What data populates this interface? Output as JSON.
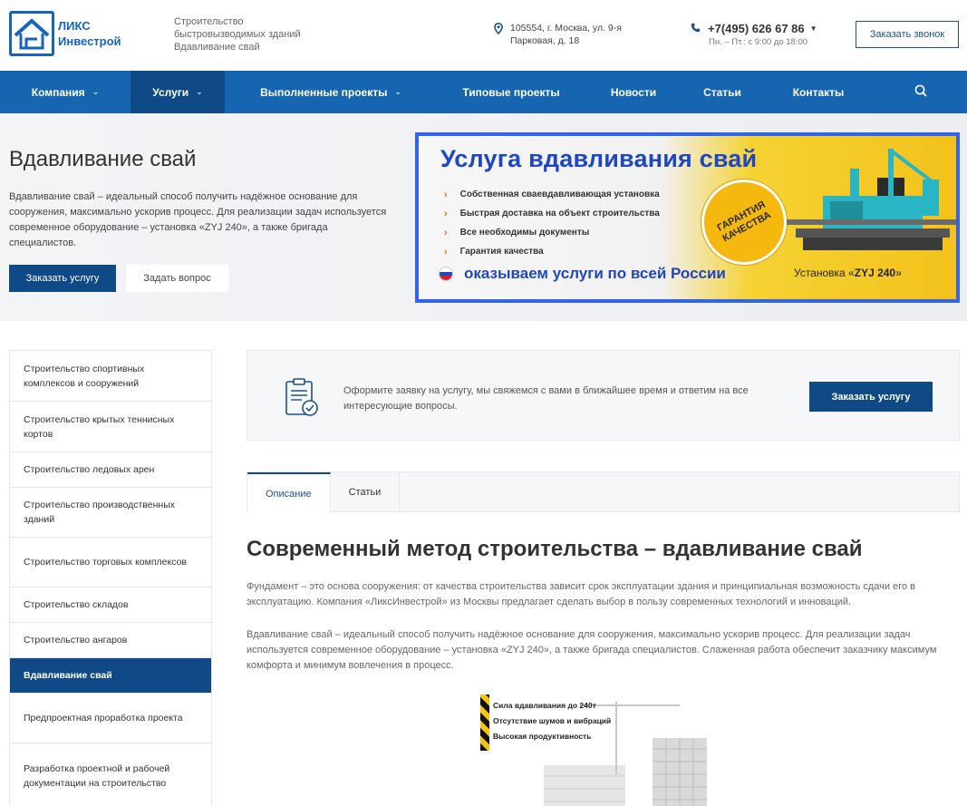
{
  "header": {
    "logo_line1": "ЛИКС",
    "logo_line2": "Инвестрой",
    "tagline": [
      "Строительство",
      "быстровызводимых зданий",
      "Вдавливание свай"
    ],
    "address_line1": "105554, г. Москва, ул. 9-я",
    "address_line2": "Парковая, д. 18",
    "phone": "+7(495) 626 67 86",
    "hours": "Пн. – Пт.: с 9:00 до 18:00",
    "callback_label": "Заказать звонок"
  },
  "nav": {
    "items": [
      {
        "label": "Компания",
        "dropdown": true
      },
      {
        "label": "Услуги",
        "dropdown": true,
        "active": true
      },
      {
        "label": "Выполненные проекты",
        "dropdown": true
      },
      {
        "label": "Типовые проекты"
      },
      {
        "label": "Новости"
      },
      {
        "label": "Статьи"
      },
      {
        "label": "Контакты"
      }
    ]
  },
  "hero": {
    "title": "Вдавливание свай",
    "text": "Вдавливание свай – идеальный способ получить надёжное основание для сооружения, максимально ускорив процесс. Для реализации задач используется современное оборудование – установка «ZYJ 240», а также бригада специалистов.",
    "primary_label": "Заказать услугу",
    "secondary_label": "Задать вопрос"
  },
  "banner": {
    "title": "Услуга вдавливания свай",
    "points": [
      "Собственная сваевдавливающая установка",
      "Быстрая доставка на объект строительства",
      "Все необходимы документы",
      "Гарантия качества"
    ],
    "footer": "оказываем услуги по всей России",
    "stamp_line1": "ГАРАНТИЯ",
    "stamp_line2": "КАЧЕСТВА",
    "caption_prefix": "Установка «",
    "caption_model": "ZYJ 240",
    "caption_suffix": "»"
  },
  "sidebar": {
    "items": [
      "Строительство спортивных комплексов и сооружений",
      "Строительство крытых теннисных кортов",
      "Строительство ледовых арен",
      "Строительство производственных зданий",
      "Строительство торговых комплексов",
      "Строительство складов",
      "Строительство ангаров",
      "Вдавливание свай",
      "Предпроектная проработка проекта",
      "Разработка проектной и рабочей документации на строительство"
    ],
    "active_index": 7
  },
  "request": {
    "text": "Оформите заявку на услугу, мы свяжемся с вами в ближайшее время и ответим на все интересующие вопросы.",
    "button_label": "Заказать услугу"
  },
  "tabs": [
    {
      "label": "Описание",
      "active": true
    },
    {
      "label": "Статьи"
    }
  ],
  "content": {
    "heading": "Современный метод строительства – вдавливание свай",
    "p1": "Фундамент – это основа сооружения: от качества строительства зависит срок эксплуатации здания и принципиальная возможность сдачи его в эксплуатацию. Компания «ЛиксИнвестрой» из Москвы предлагает сделать выбор в пользу современных технологий и инноваций.",
    "p2": "Вдавливание свай – идеальный способ получить надёжное основание для сооружения, максимально ускорив процесс. Для реализации задач используется современное оборудование – установка «ZYJ 240», а также бригада специалистов. Слаженная работа обеспечит заказчику максимум комфорта и минимум вовлечения в процесс.",
    "figure_items": [
      "Сила вдавливания до 240т",
      "Отсутствие шумов и вибраций",
      "Высокая продуктивность"
    ]
  },
  "colors": {
    "brand_blue": "#1565b0",
    "nav_active": "#0f4a86",
    "banner_blue": "#1f47c2",
    "banner_yellow": "#f3c21b"
  }
}
